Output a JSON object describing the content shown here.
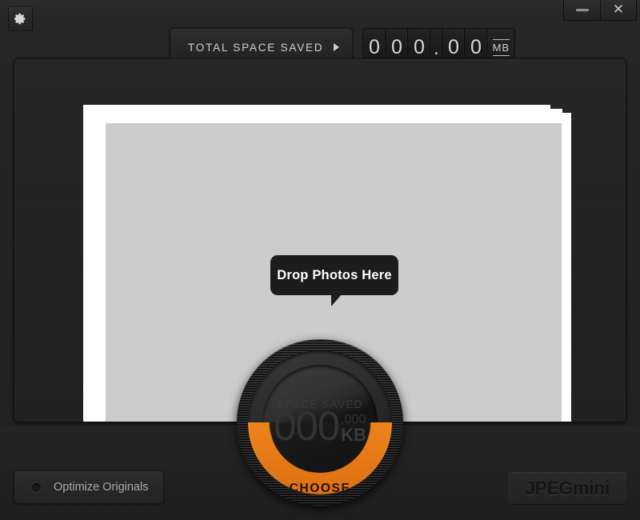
{
  "window": {
    "title": "JPEGmini",
    "minimize_label": "–",
    "close_label": "✕"
  },
  "header": {
    "settings_icon": "gear-icon",
    "total_space_saved_label": "TOTAL SPACE SAVED",
    "expand_arrow": "▶",
    "counter_digits": [
      "0",
      "0",
      "0",
      ".",
      "0",
      "0"
    ],
    "counter_unit": "MB"
  },
  "drop_area": {
    "tooltip_text": "Drop Photos Here",
    "photo_count": 3
  },
  "dial": {
    "title": "SPACE SAVED",
    "value": "000",
    "decimals": ".000",
    "unit": "KB",
    "button_label": "CHOOSE",
    "accent_color": "#ef851c"
  },
  "footer": {
    "optimize_originals_label": "Optimize Originals",
    "optimize_originals_checked": false,
    "brand_label": "JPEGmini"
  }
}
